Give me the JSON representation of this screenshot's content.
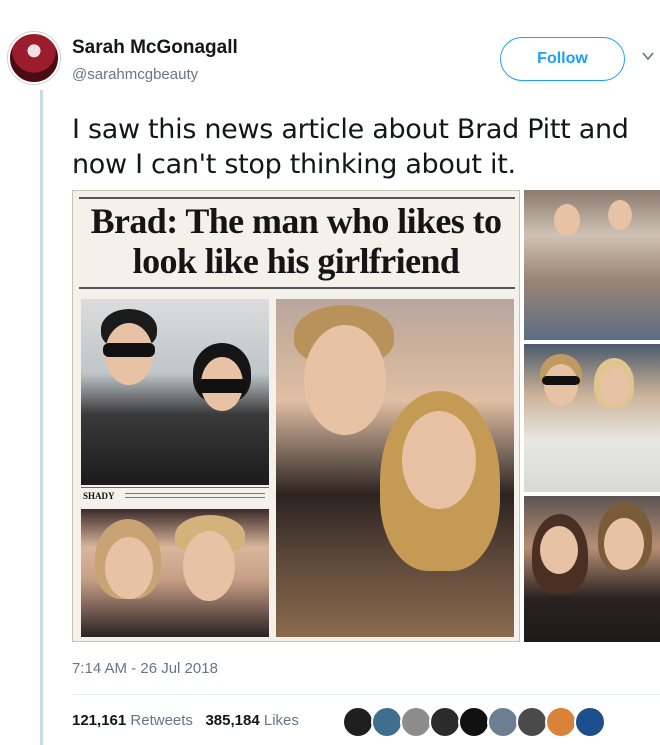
{
  "tweet": {
    "display_name": "Sarah McGonagall",
    "handle": "@sarahmcgbeauty",
    "follow_label": "Follow",
    "text": "I saw this news article about Brad Pitt and now I can't stop thinking about it.",
    "timestamp": "7:14 AM - 26 Jul 2018"
  },
  "media": {
    "headline": "Brad: The man who likes to look like his girlfriend",
    "caption_label": "SHADY"
  },
  "stats": {
    "retweets_count": "121,161",
    "retweets_label": "Retweets",
    "likes_count": "385,184",
    "likes_label": "Likes"
  },
  "likers": [
    {
      "color": "#1f1f1f"
    },
    {
      "color": "#3f6e8f"
    },
    {
      "color": "#8c8c8c"
    },
    {
      "color": "#2b2b2b"
    },
    {
      "color": "#111111"
    },
    {
      "color": "#6d7e93"
    },
    {
      "color": "#4a4a4a"
    },
    {
      "color": "#d9823a"
    },
    {
      "color": "#1d4f8c"
    }
  ],
  "colors": {
    "accent": "#1da1f2",
    "secondary_text": "#657786",
    "thread_line": "#c7dbe8"
  }
}
